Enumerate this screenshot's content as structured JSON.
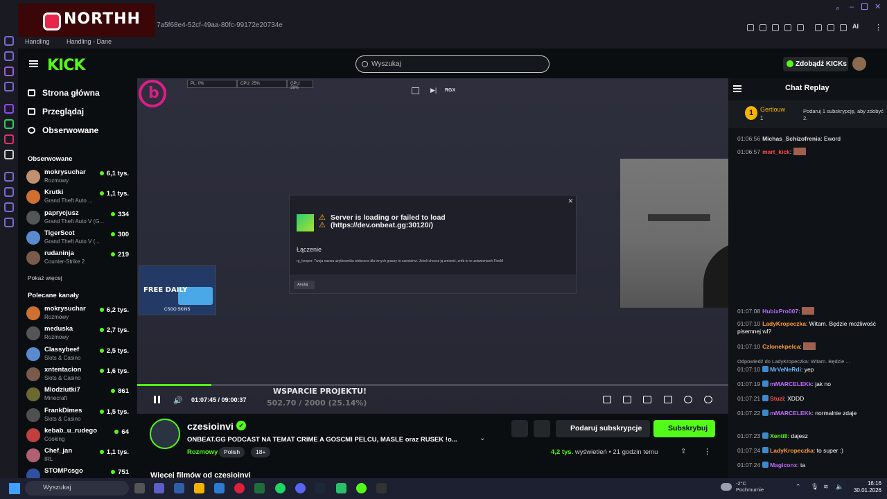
{
  "browser": {
    "address": "7a5f68e4-52cf-49aa-80fc-99172e20734e",
    "bookmarks": [
      "Handling",
      "Handling - Dane"
    ],
    "ai_label": "AI",
    "overlay_brand": "NORTHH"
  },
  "kick": {
    "logo": "KICK",
    "search_placeholder": "Wyszukaj",
    "get_kicks": "Zdobądź KICKs"
  },
  "sidebar": {
    "nav": [
      "Strona główna",
      "Przeglądaj",
      "Obserwowane"
    ],
    "followed_title": "Obserwowane",
    "followed": [
      {
        "name": "mokrysuchar",
        "category": "Rozmowy",
        "viewers": "6,1 tys."
      },
      {
        "name": "Krutki",
        "category": "Grand Theft Auto ...",
        "viewers": "1,1 tys."
      },
      {
        "name": "paprycjusz",
        "category": "Grand Theft Auto V (G...",
        "viewers": "334"
      },
      {
        "name": "TigerScot",
        "category": "Grand Theft Auto V (...",
        "viewers": "300"
      },
      {
        "name": "rudaninja",
        "category": "Counter-Strike 2",
        "viewers": "219"
      }
    ],
    "show_more": "Pokaż więcej",
    "recommended_title": "Polecane kanały",
    "recommended": [
      {
        "name": "mokrysuchar",
        "category": "Rozmowy",
        "viewers": "6,2 tys."
      },
      {
        "name": "meduska",
        "category": "Rozmowy",
        "viewers": "2,7 tys."
      },
      {
        "name": "Classybeef",
        "category": "Slots & Casino",
        "viewers": "2,5 tys."
      },
      {
        "name": "xntentacion",
        "category": "Slots & Casino",
        "viewers": "1,6 tys."
      },
      {
        "name": "Mlodziutki7",
        "category": "Minecraft",
        "viewers": "861"
      },
      {
        "name": "FrankDimes",
        "category": "Slots & Casino",
        "viewers": "1,5 tys."
      },
      {
        "name": "kebab_u_rudego",
        "category": "Cooking",
        "viewers": "64"
      },
      {
        "name": "Chef_jan",
        "category": "IRL",
        "viewers": "1,1 tys."
      },
      {
        "name": "STOMPcsgo",
        "category": "",
        "viewers": "751"
      }
    ]
  },
  "player": {
    "stats": [
      "PL: 0%",
      "CPU: 25%",
      "GPU: 38%"
    ],
    "rgx": "RGX",
    "dialog": {
      "message": "Server is loading or failed to load (https://dev.onbeat.gg:30120/)",
      "connecting": "Łączenie",
      "info": "rg_keeper: Twoja nazwa użytkownika widoczna dla innych graczy to czesioinvi. Jeżeli chcesz ją zmienić, zrób to w ustawieniach FiveM",
      "cancel": "Anuluj"
    },
    "ad": {
      "free": "FREE DAILY",
      "site": "CSGO SKINS"
    },
    "time": "01:07:45 / 09:00:37",
    "progress": 0.125,
    "goal_title": "WSPARCIE PROJEKTU!",
    "goal_value": "502.70 / 2000 (25.14%)"
  },
  "stream": {
    "streamer": "czesioinvi",
    "title": "ONBEAT.GG PODCAST NA TEMAT CRIME A GOSCMI PELCU, MASLE oraz RUSEK !o...",
    "category": "Rozmowy",
    "tags": [
      "Polish",
      "18+"
    ],
    "gift_button": "Podaruj subskrypcje",
    "subscribe_button": "Subskrybuj",
    "viewers": "4,2 tys.",
    "viewers_label": "wyświetleń",
    "ago": "21 godzin temu",
    "more_videos": "Więcej filmów od czesioinvi"
  },
  "chat": {
    "title": "Chat Replay",
    "pinned": {
      "rank": "1",
      "name": "Gertlouw",
      "count": "1",
      "gift_text": "Podaruj 1 subskrypcję, aby zdobyć 2."
    },
    "messages": [
      {
        "time": "01:06:56",
        "user": "Michas_Schizofrenia",
        "color": "#dddddd",
        "text": "Eword"
      },
      {
        "time": "01:06:57",
        "user": "mart_kick",
        "color": "#ff4d4d",
        "text": ""
      },
      {
        "time": "01:07:08",
        "user": "HubixPro007",
        "color": "#b76cff",
        "text": ""
      },
      {
        "time": "01:07:10",
        "user": "LadyKropeczka",
        "color": "#ff9d3a",
        "text": "Witam. Będzie możliwość pisemnej wl?"
      },
      {
        "time": "01:07:10",
        "user": "Czlonekpelca",
        "color": "#ff9d3a",
        "text": ""
      },
      {
        "time": "",
        "user": "",
        "color": "#aaaaaa",
        "text": "Odpowiedź do LadyKropeczka: Witam. Będzie ..."
      },
      {
        "time": "01:07:10",
        "user": "MrVeNeRdi",
        "color": "#6cb8ff",
        "text": "yep"
      },
      {
        "time": "01:07:19",
        "user": "mMARCELEKk",
        "color": "#c06cff",
        "text": "jak no"
      },
      {
        "time": "01:07:21",
        "user": "Stuzi",
        "color": "#ff4d4d",
        "text": "XDDD"
      },
      {
        "time": "01:07:22",
        "user": "mMARCELEKk",
        "color": "#c06cff",
        "text": "normalnie zdaje"
      },
      {
        "time": "01:07:23",
        "user": "Xentill",
        "color": "#53fc18",
        "text": "dajesz"
      },
      {
        "time": "01:07:24",
        "user": "LadyKropeczka",
        "color": "#ff9d3a",
        "text": "to super :)"
      },
      {
        "time": "01:07:24",
        "user": "Magiconx",
        "color": "#c06cff",
        "text": "ta"
      }
    ]
  },
  "taskbar": {
    "search": "Wyszukaj",
    "weather_temp": "-2°C",
    "weather_desc": "Pochmurnie",
    "time": "16:16",
    "date": "30.01.2026"
  }
}
